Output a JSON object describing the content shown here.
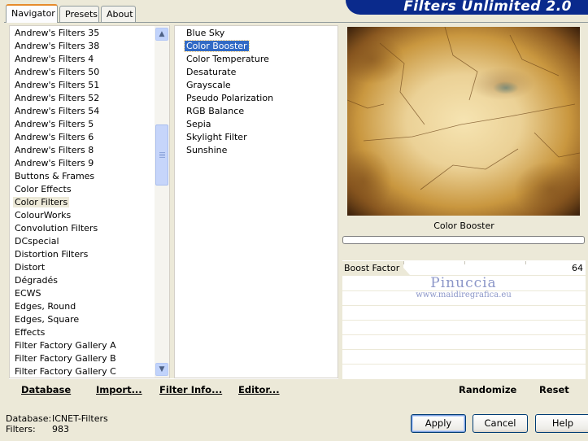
{
  "tabs": [
    {
      "label": "Navigator",
      "active": true
    },
    {
      "label": "Presets",
      "active": false
    },
    {
      "label": "About",
      "active": false
    }
  ],
  "banner_title": "Filters Unlimited 2.0",
  "categories": [
    {
      "label": "Andrew's Filters 35"
    },
    {
      "label": "Andrew's Filters 38"
    },
    {
      "label": "Andrew's Filters 4"
    },
    {
      "label": "Andrew's Filters 50"
    },
    {
      "label": "Andrew's Filters 51"
    },
    {
      "label": "Andrew's Filters 52"
    },
    {
      "label": "Andrew's Filters 54"
    },
    {
      "label": "Andrew's Filters 5"
    },
    {
      "label": "Andrew's Filters 6"
    },
    {
      "label": "Andrew's Filters 8"
    },
    {
      "label": "Andrew's Filters 9"
    },
    {
      "label": "Buttons & Frames"
    },
    {
      "label": "Color Effects"
    },
    {
      "label": "Color Filters",
      "selected": true
    },
    {
      "label": "ColourWorks"
    },
    {
      "label": "Convolution Filters"
    },
    {
      "label": "DCspecial"
    },
    {
      "label": "Distortion Filters"
    },
    {
      "label": "Distort"
    },
    {
      "label": "Dégradés"
    },
    {
      "label": "ECWS"
    },
    {
      "label": "Edges, Round"
    },
    {
      "label": "Edges, Square"
    },
    {
      "label": "Effects"
    },
    {
      "label": "Filter Factory Gallery A"
    },
    {
      "label": "Filter Factory Gallery B"
    },
    {
      "label": "Filter Factory Gallery C"
    }
  ],
  "filters": [
    {
      "label": "Blue Sky"
    },
    {
      "label": "Color Booster",
      "selected": true
    },
    {
      "label": "Color Temperature"
    },
    {
      "label": "Desaturate"
    },
    {
      "label": "Grayscale"
    },
    {
      "label": "Pseudo Polarization"
    },
    {
      "label": "RGB Balance"
    },
    {
      "label": "Sepia"
    },
    {
      "label": "Skylight Filter"
    },
    {
      "label": "Sunshine"
    }
  ],
  "left_toolbar": {
    "database": "Database",
    "import": "Import...",
    "filter_info": "Filter Info...",
    "editor": "Editor..."
  },
  "preview": {
    "filter_name": "Color Booster"
  },
  "parameters": [
    {
      "label": "Boost Factor",
      "value": "64",
      "fraction": 0.251
    }
  ],
  "watermark": {
    "name": "Pinuccia",
    "url": "www.maidiregrafica.eu"
  },
  "right_toolbar": {
    "randomize": "Randomize",
    "reset": "Reset"
  },
  "status": {
    "database_label": "Database:",
    "database_value": "ICNET-Filters",
    "filters_label": "Filters:",
    "filters_value": "983"
  },
  "buttons": {
    "apply": "Apply",
    "cancel": "Cancel",
    "help": "Help"
  }
}
